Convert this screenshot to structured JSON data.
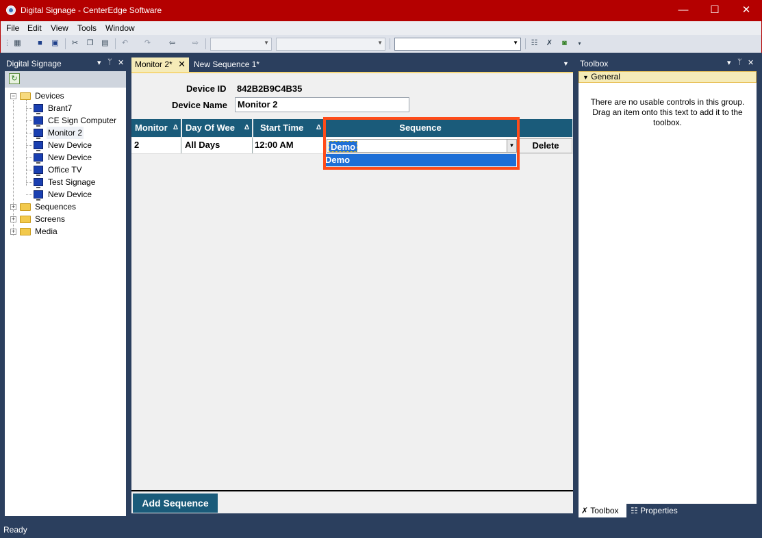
{
  "window": {
    "title": "Digital Signage - CenterEdge Software",
    "minimize": "—",
    "maximize": "☐",
    "close": "✕"
  },
  "menu": [
    "File",
    "Edit",
    "View",
    "Tools",
    "Window"
  ],
  "left_panel": {
    "title": "Digital Signage",
    "tree": {
      "devices_label": "Devices",
      "devices": [
        "Brant7",
        "CE Sign Computer",
        "Monitor 2",
        "New Device",
        "New Device",
        "Office TV",
        "Test Signage",
        "New Device"
      ],
      "other_folders": [
        "Sequences",
        "Screens",
        "Media"
      ]
    }
  },
  "tabs": [
    {
      "label": "Monitor 2*",
      "active": true
    },
    {
      "label": "New Sequence 1*",
      "active": false
    }
  ],
  "form": {
    "device_id_label": "Device ID",
    "device_id_value": "842B2B9C4B35",
    "device_name_label": "Device Name",
    "device_name_value": "Monitor 2"
  },
  "grid": {
    "headers": [
      "Monitor",
      "Day Of Wee",
      "Start Time",
      "Sequence"
    ],
    "sort_glyph": "Δ",
    "row": {
      "monitor": "2",
      "day": "All Days",
      "start": "12:00 AM",
      "sequence": "Demo"
    },
    "delete_label": "Delete",
    "dropdown_options": [
      "Demo"
    ]
  },
  "add_sequence_label": "Add Sequence",
  "right_panel": {
    "title": "Toolbox",
    "group": "General",
    "empty_text": "There are no usable controls in this group. Drag an item onto this text to add it to the toolbox.",
    "tabs": [
      "Toolbox",
      "Properties"
    ]
  },
  "status": "Ready"
}
